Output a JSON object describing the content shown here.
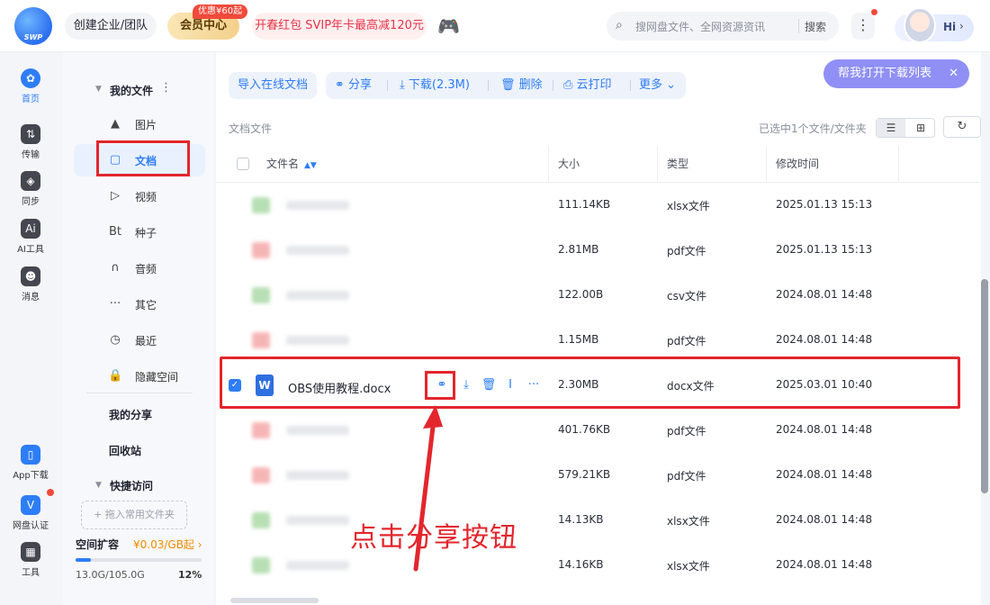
{
  "topbar": {
    "logo_text": "SWP",
    "team_button": "创建企业/团队",
    "vip_badge": "优惠¥60起",
    "vip_center": "会员中心",
    "promo": "开春红包 SVIP年卡最高减120元",
    "search_placeholder": "搜网盘文件、全网资源资讯",
    "search_button": "搜索",
    "greeting": "Hi"
  },
  "rail": {
    "items": [
      {
        "label": "首页",
        "icon": "home-icon"
      },
      {
        "label": "传输",
        "icon": "transfer-icon"
      },
      {
        "label": "同步",
        "icon": "sync-icon"
      },
      {
        "label": "AI工具",
        "icon": "ai-icon"
      },
      {
        "label": "消息",
        "icon": "message-icon"
      }
    ],
    "bottom": [
      {
        "label": "App下载",
        "icon": "phone-icon"
      },
      {
        "label": "网盘认证",
        "icon": "verify-icon"
      },
      {
        "label": "工具",
        "icon": "tools-icon"
      }
    ]
  },
  "sidebar": {
    "my_files": "我的文件",
    "categories": [
      {
        "label": "图片",
        "glyph": "▲"
      },
      {
        "label": "文档",
        "glyph": "▢"
      },
      {
        "label": "视频",
        "glyph": "▷"
      },
      {
        "label": "种子",
        "glyph": "Bt"
      },
      {
        "label": "音频",
        "glyph": "∩"
      },
      {
        "label": "其它",
        "glyph": "···"
      },
      {
        "label": "最近",
        "glyph": "◷"
      },
      {
        "label": "隐藏空间",
        "glyph": "🔒"
      }
    ],
    "my_share": "我的分享",
    "recycle": "回收站",
    "quick_access": "快捷访问",
    "drop_hint": "+ 拖入常用文件夹",
    "expand_title": "空间扩容",
    "expand_price": "¥0.03/GB起 ›",
    "usage": "13.0G/105.0G",
    "usage_pct": "12%",
    "usage_fraction": 0.12
  },
  "toolbar": {
    "import": "导入在线文档",
    "share": "分享",
    "download": "下载(2.3M)",
    "delete": "删除",
    "print": "云打印",
    "more": "更多",
    "help": "帮我打开下载列表"
  },
  "list": {
    "folder": "文档文件",
    "selection": "已选中1个文件/文件夹",
    "headers": {
      "name": "文件名",
      "size": "大小",
      "type": "类型",
      "mtime": "修改时间"
    },
    "rows": [
      {
        "size": "111.14KB",
        "type": "xlsx文件",
        "mtime": "2025.01.13 15:13",
        "color": "#7cc576"
      },
      {
        "size": "2.81MB",
        "type": "pdf文件",
        "mtime": "2025.01.13 15:13",
        "color": "#f07a7a"
      },
      {
        "size": "122.00B",
        "type": "csv文件",
        "mtime": "2024.08.01 14:48",
        "color": "#7cc576"
      },
      {
        "size": "1.15MB",
        "type": "pdf文件",
        "mtime": "2024.08.01 14:48",
        "color": "#f07a7a"
      },
      {
        "size": "2.30MB",
        "type": "docx文件",
        "mtime": "2025.03.01 10:40",
        "name": "OBS使用教程.docx",
        "selected": true
      },
      {
        "size": "401.76KB",
        "type": "pdf文件",
        "mtime": "2024.08.01 14:48",
        "color": "#f07a7a"
      },
      {
        "size": "579.21KB",
        "type": "pdf文件",
        "mtime": "2024.08.01 14:48",
        "color": "#f07a7a"
      },
      {
        "size": "14.13KB",
        "type": "xlsx文件",
        "mtime": "2024.08.01 14:48",
        "color": "#7cc576"
      },
      {
        "size": "14.16KB",
        "type": "xlsx文件",
        "mtime": "2024.08.01 14:48",
        "color": "#7cc576"
      }
    ]
  },
  "annotation": {
    "callout": "点击分享按钮",
    "color": "#e3262d"
  }
}
